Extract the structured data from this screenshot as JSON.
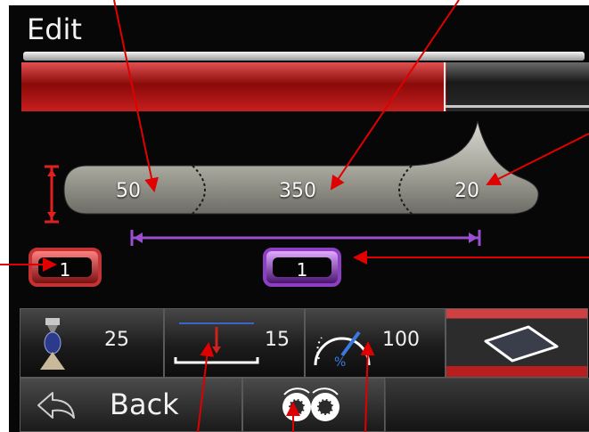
{
  "window": {
    "title": "Edit"
  },
  "progress_bar": {
    "fill_fraction": 0.745,
    "fill_color": "#c81e1e"
  },
  "shape_editor": {
    "left_value": "50",
    "middle_value": "350",
    "right_value": "20"
  },
  "spinners": {
    "left": {
      "value": "1",
      "color": "#c43333"
    },
    "right": {
      "value": "1",
      "color": "#8c3fc2"
    }
  },
  "settings": {
    "height_value": "25",
    "depth_value": "15",
    "speed_value": "100"
  },
  "nav": {
    "back_label": "Back"
  },
  "annotation_color": "#e00000",
  "icons": [
    "red-ibeam-icon",
    "purple-dimension-icon",
    "vial-icon",
    "depth-gauge-icon",
    "speed-dial-icon",
    "diamond-icon",
    "back-arrow-icon",
    "compare-gears-icon"
  ]
}
